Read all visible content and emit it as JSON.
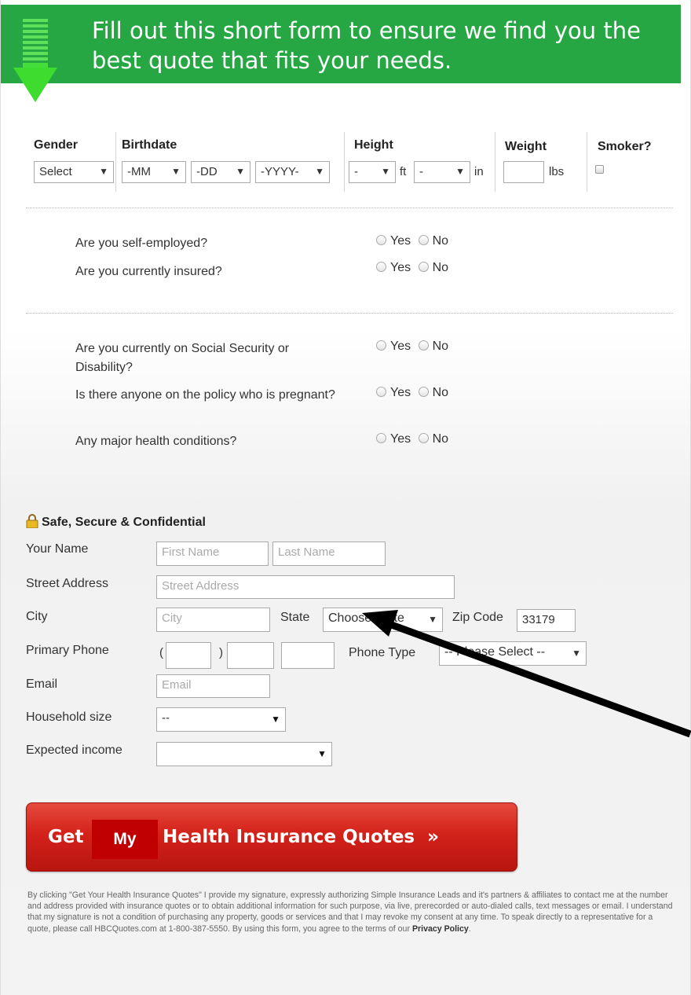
{
  "banner": {
    "text": "Fill out this short form to ensure we find you the best quote that fits your needs.",
    "color": "#27a744"
  },
  "top_row": {
    "gender_label": "Gender",
    "gender_value": "Select",
    "birthdate_label": "Birthdate",
    "month_value": "-MM",
    "day_value": "-DD",
    "year_value": "-YYYY-",
    "height_label": "Height",
    "feet_value": "-",
    "feet_unit": "ft",
    "inches_value": "-",
    "inches_unit": "in",
    "weight_label": "Weight",
    "weight_unit": "lbs",
    "smoker_label": "Smoker?"
  },
  "questions": {
    "yes": "Yes",
    "no": "No",
    "self_employed": "Are you self-employed?",
    "insured": "Are you currently insured?",
    "social_security": "Are you currently on Social Security or Disability?",
    "pregnant": "Is there anyone on the policy who is pregnant?",
    "health_conditions": "Any major health conditions?"
  },
  "contact": {
    "secure_title": "Safe, Secure & Confidential",
    "name_label": "Your Name",
    "first_name_placeholder": "First Name",
    "last_name_placeholder": "Last Name",
    "street_label": "Street Address",
    "street_placeholder": "Street Address",
    "city_label": "City",
    "city_placeholder": "City",
    "state_label": "State",
    "state_value": "Choose State",
    "zip_label": "Zip Code",
    "zip_value": "33179",
    "phone_label": "Primary Phone",
    "phone_open": "(",
    "phone_close": ")",
    "phone_type_label": "Phone Type",
    "phone_type_value": "-- Please Select --",
    "email_label": "Email",
    "email_placeholder": "Email",
    "household_label": "Household size",
    "household_value": "--",
    "income_label": "Expected income",
    "income_value": ""
  },
  "cta": {
    "get": "Get",
    "my": "My",
    "rest": "Health Insurance Quotes",
    "chevron": "»",
    "color": "#d3221a"
  },
  "disclaimer": {
    "text": "By clicking \"Get Your Health Insurance Quotes\" I provide my signature, expressly authorizing Simple Insurance Leads and it's partners & affiliates to contact me at the number and address provided with insurance quotes or to obtain additional information for such purpose, via live, prerecorded or auto-dialed calls, text messages or email. I understand that my signature is not a condition of purchasing any property, goods or services and that I may revoke my consent at any time. To speak directly to a representative for a quote, please call HBCQuotes.com at 1-800-387-5550. By using this form, you agree to the terms of our ",
    "link": "Privacy Policy",
    "end": "."
  }
}
